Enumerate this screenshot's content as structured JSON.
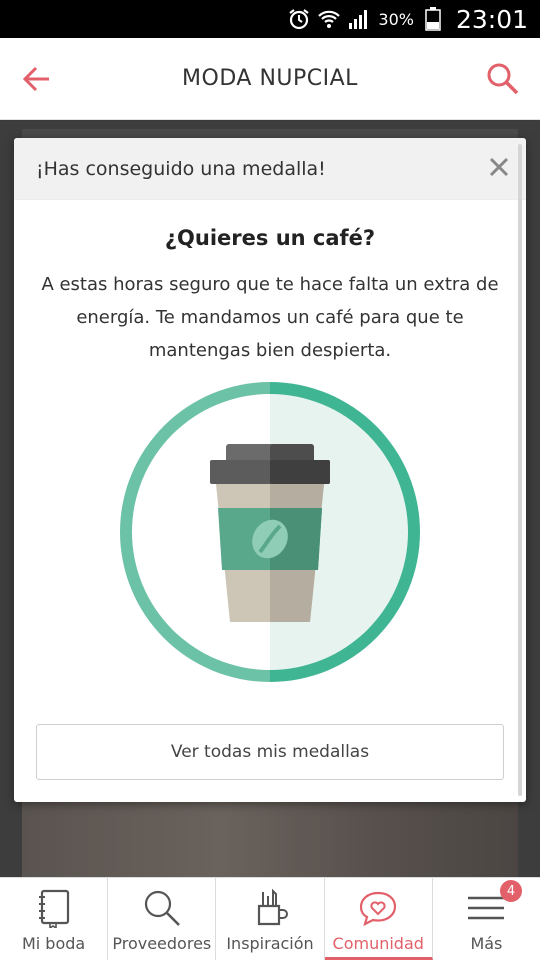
{
  "status_bar": {
    "battery_percent": "30%",
    "time": "23:01",
    "icons": [
      "alarm-icon",
      "wifi-icon",
      "signal-icon",
      "battery-icon"
    ]
  },
  "header": {
    "title": "MODA NUPCIAL",
    "back_icon": "arrow-left-icon",
    "search_icon": "search-icon"
  },
  "modal": {
    "header_title": "¡Has conseguido una medalla!",
    "close_icon": "close-icon",
    "badge_title": "¿Quieres un café?",
    "badge_description": "A estas horas seguro que te hace falta un extra de energía. Te mandamos un café para que te mantengas bien despierta.",
    "medal_icon": "coffee-cup-icon",
    "all_medals_button": "Ver todas mis medallas"
  },
  "colors": {
    "accent": "#e2606a",
    "medal_green": "#3fb594"
  },
  "bottom_nav": {
    "items": [
      {
        "label": "Mi boda",
        "icon": "notebook-icon"
      },
      {
        "label": "Proveedores",
        "icon": "magnifier-icon"
      },
      {
        "label": "Inspiración",
        "icon": "pencil-cup-icon"
      },
      {
        "label": "Comunidad",
        "icon": "heart-chat-icon"
      },
      {
        "label": "Más",
        "icon": "menu-icon",
        "badge": "4"
      }
    ],
    "active": "Comunidad"
  }
}
